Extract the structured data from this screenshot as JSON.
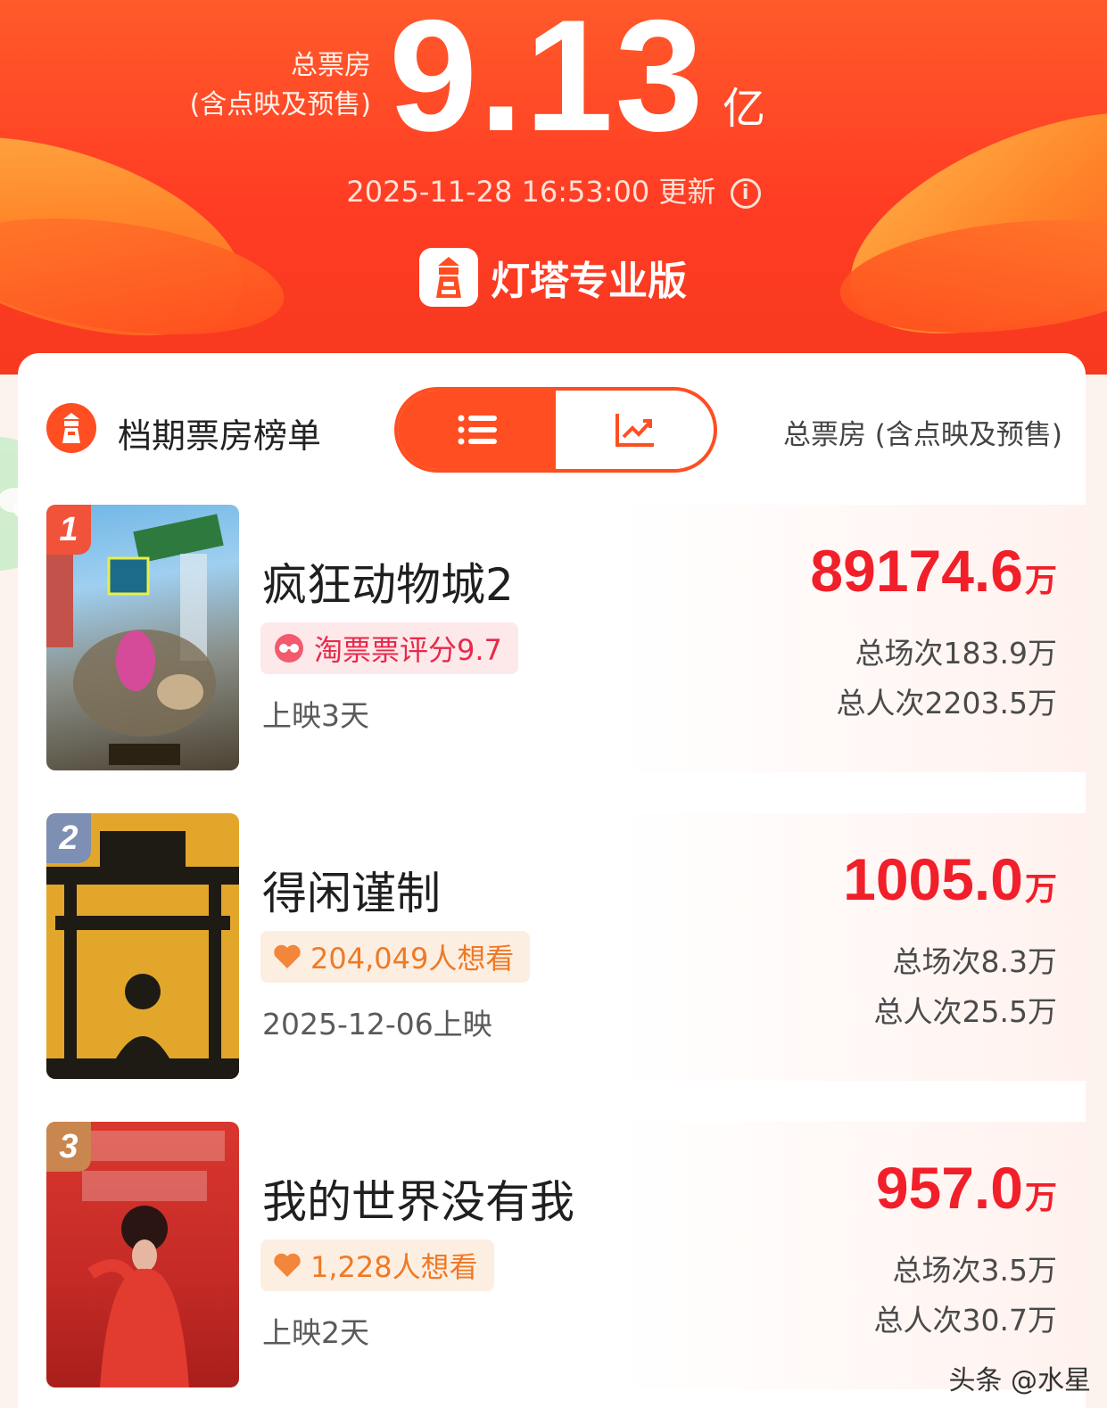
{
  "header": {
    "total_label_line1": "总票房",
    "total_label_line2": "(含点映及预售)",
    "total_value": "9.13",
    "total_unit": "亿",
    "update_time": "2025-11-28 16:53:00 更新",
    "brand_name": "灯塔专业版"
  },
  "board": {
    "title": "档期票房榜单",
    "toggle": [
      "list-view-icon",
      "trend-chart-icon"
    ],
    "subtitle": "总票房 (含点映及预售)"
  },
  "movies": [
    {
      "rank": "1",
      "title": "疯狂动物城2",
      "tag": "淘票票评分9.7",
      "sub_info": "上映3天",
      "gross": "89174.6",
      "gross_unit": "万",
      "shows": "总场次183.9万",
      "admissions": "总人次2203.5万"
    },
    {
      "rank": "2",
      "title": "得闲谨制",
      "tag": "204,049人想看",
      "sub_info": "2025-12-06上映",
      "gross": "1005.0",
      "gross_unit": "万",
      "shows": "总场次8.3万",
      "admissions": "总人次25.5万"
    },
    {
      "rank": "3",
      "title": "我的世界没有我",
      "tag": "1,228人想看",
      "sub_info": "上映2天",
      "gross": "957.0",
      "gross_unit": "万",
      "shows": "总场次3.5万",
      "admissions": "总人次30.7万"
    }
  ],
  "watermark": "头条 @水星",
  "colors": {
    "header_orange": "#ff3c24",
    "accent": "#ff4e21",
    "gross_red": "#f11f2a",
    "rating_red": "#e8294b",
    "wish_orange": "#ee7a26"
  }
}
